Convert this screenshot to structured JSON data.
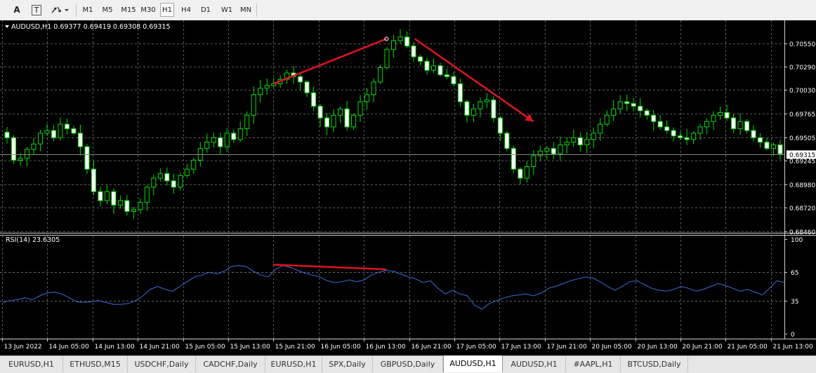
{
  "toolbar": {
    "text_tool": "A",
    "label_tool": "T",
    "timeframes": [
      "M1",
      "M5",
      "M15",
      "M30",
      "H1",
      "H4",
      "D1",
      "W1",
      "MN"
    ],
    "selected_timeframe": "H1"
  },
  "tabs": {
    "items": [
      "EURUSD,H1",
      "ETHUSD,M15",
      "USDCHF,Daily",
      "CADCHF,Daily",
      "EURUSD,H1",
      "SPX,Daily",
      "GBPUSD,Daily",
      "AUDUSD,H1",
      "AUDUSD,H1",
      "#AAPL,H1",
      "BTCUSD,Daily"
    ],
    "active_index": 7
  },
  "chart_data": [
    {
      "type": "candlestick",
      "title": "AUDUSD,H1  0.69377 0.69419 0.69308 0.69315",
      "symbol": "AUDUSD,H1",
      "ohlc_header": [
        "0.69377",
        "0.69419",
        "0.69308",
        "0.69315"
      ],
      "ylim": [
        0.6845,
        0.7079
      ],
      "yticks": [
        "0.70550",
        "0.70290",
        "0.70030",
        "0.69765",
        "0.69505",
        "0.69245",
        "0.68980",
        "0.68720",
        "0.68460"
      ],
      "current_price": "0.69315",
      "x_ticks": [
        "13 Jun 2022",
        "14 Jun 05:00",
        "14 Jun 13:00",
        "14 Jun 21:00",
        "15 Jun 05:00",
        "15 Jun 13:00",
        "15 Jun 21:00",
        "16 Jun 05:00",
        "16 Jun 13:00",
        "16 Jun 21:00",
        "17 Jun 05:00",
        "17 Jun 13:00",
        "17 Jun 21:00",
        "20 Jun 05:00",
        "20 Jun 13:00",
        "20 Jun 21:00",
        "21 Jun 05:00",
        "21 Jun 13:00"
      ],
      "close_path": [
        0.695,
        0.6925,
        0.6927,
        0.6937,
        0.6943,
        0.6955,
        0.6958,
        0.695,
        0.6965,
        0.696,
        0.6955,
        0.694,
        0.6915,
        0.689,
        0.688,
        0.689,
        0.6875,
        0.688,
        0.6868,
        0.687,
        0.6878,
        0.6895,
        0.6905,
        0.691,
        0.6902,
        0.6895,
        0.6908,
        0.6915,
        0.6925,
        0.6938,
        0.6945,
        0.695,
        0.694,
        0.6955,
        0.6948,
        0.696,
        0.6975,
        0.6998,
        0.7005,
        0.7008,
        0.701,
        0.7015,
        0.7022,
        0.7018,
        0.7012,
        0.7,
        0.6985,
        0.6972,
        0.6962,
        0.6975,
        0.6982,
        0.6962,
        0.6975,
        0.699,
        0.6998,
        0.7012,
        0.7028,
        0.7048,
        0.7058,
        0.7062,
        0.7052,
        0.704,
        0.7035,
        0.7025,
        0.703,
        0.702,
        0.7018,
        0.701,
        0.699,
        0.6975,
        0.6982,
        0.699,
        0.6992,
        0.6972,
        0.6955,
        0.6938,
        0.6915,
        0.6905,
        0.6918,
        0.693,
        0.6935,
        0.6938,
        0.6932,
        0.6942,
        0.6945,
        0.695,
        0.6942,
        0.6948,
        0.6955,
        0.6965,
        0.6975,
        0.6982,
        0.699,
        0.6988,
        0.6985,
        0.698,
        0.6975,
        0.6968,
        0.6962,
        0.6958,
        0.6952,
        0.695,
        0.6948,
        0.6955,
        0.6962,
        0.6968,
        0.6975,
        0.6978,
        0.6972,
        0.696,
        0.6968,
        0.6958,
        0.695,
        0.6945,
        0.6938,
        0.6942,
        0.6932
      ],
      "annotations": [
        {
          "kind": "trendline",
          "from": [
            "15 Jun 21:00",
            0.701
          ],
          "to": [
            "16 Jun 17:00",
            0.706
          ]
        },
        {
          "kind": "arrow",
          "from": [
            "16 Jun 22:00",
            0.706
          ],
          "to": [
            "17 Jun 19:00",
            0.6968
          ]
        }
      ]
    },
    {
      "type": "line",
      "title": "RSI(14) 23.6305",
      "indicator": "RSI(14)",
      "last_value": "23.6305",
      "ylim": [
        0,
        100
      ],
      "yticks": [
        "100",
        "65",
        "35",
        "0"
      ],
      "levels": [
        65,
        35
      ],
      "values": [
        33,
        35,
        36,
        38,
        36,
        40,
        43,
        44,
        42,
        38,
        34,
        33,
        34,
        35,
        33,
        31,
        31,
        32,
        35,
        40,
        47,
        50,
        47,
        45,
        50,
        55,
        60,
        62,
        65,
        63,
        66,
        71,
        72,
        71,
        66,
        62,
        60,
        68,
        72,
        70,
        67,
        64,
        62,
        60,
        56,
        54,
        55,
        57,
        55,
        57,
        62,
        65,
        67,
        66,
        63,
        60,
        58,
        54,
        56,
        48,
        42,
        46,
        42,
        40,
        30,
        26,
        32,
        35,
        38,
        40,
        41,
        42,
        40,
        43,
        48,
        50,
        53,
        56,
        58,
        60,
        59,
        55,
        50,
        46,
        50,
        55,
        56,
        52,
        48,
        46,
        45,
        47,
        50,
        48,
        45,
        47,
        50,
        53,
        51,
        48,
        45,
        47,
        44,
        41,
        48,
        56,
        54
      ],
      "annotations": [
        {
          "kind": "trendline",
          "from": [
            "15 Jun 21:00",
            73
          ],
          "to": [
            "16 Jun 17:00",
            68
          ]
        }
      ]
    }
  ]
}
